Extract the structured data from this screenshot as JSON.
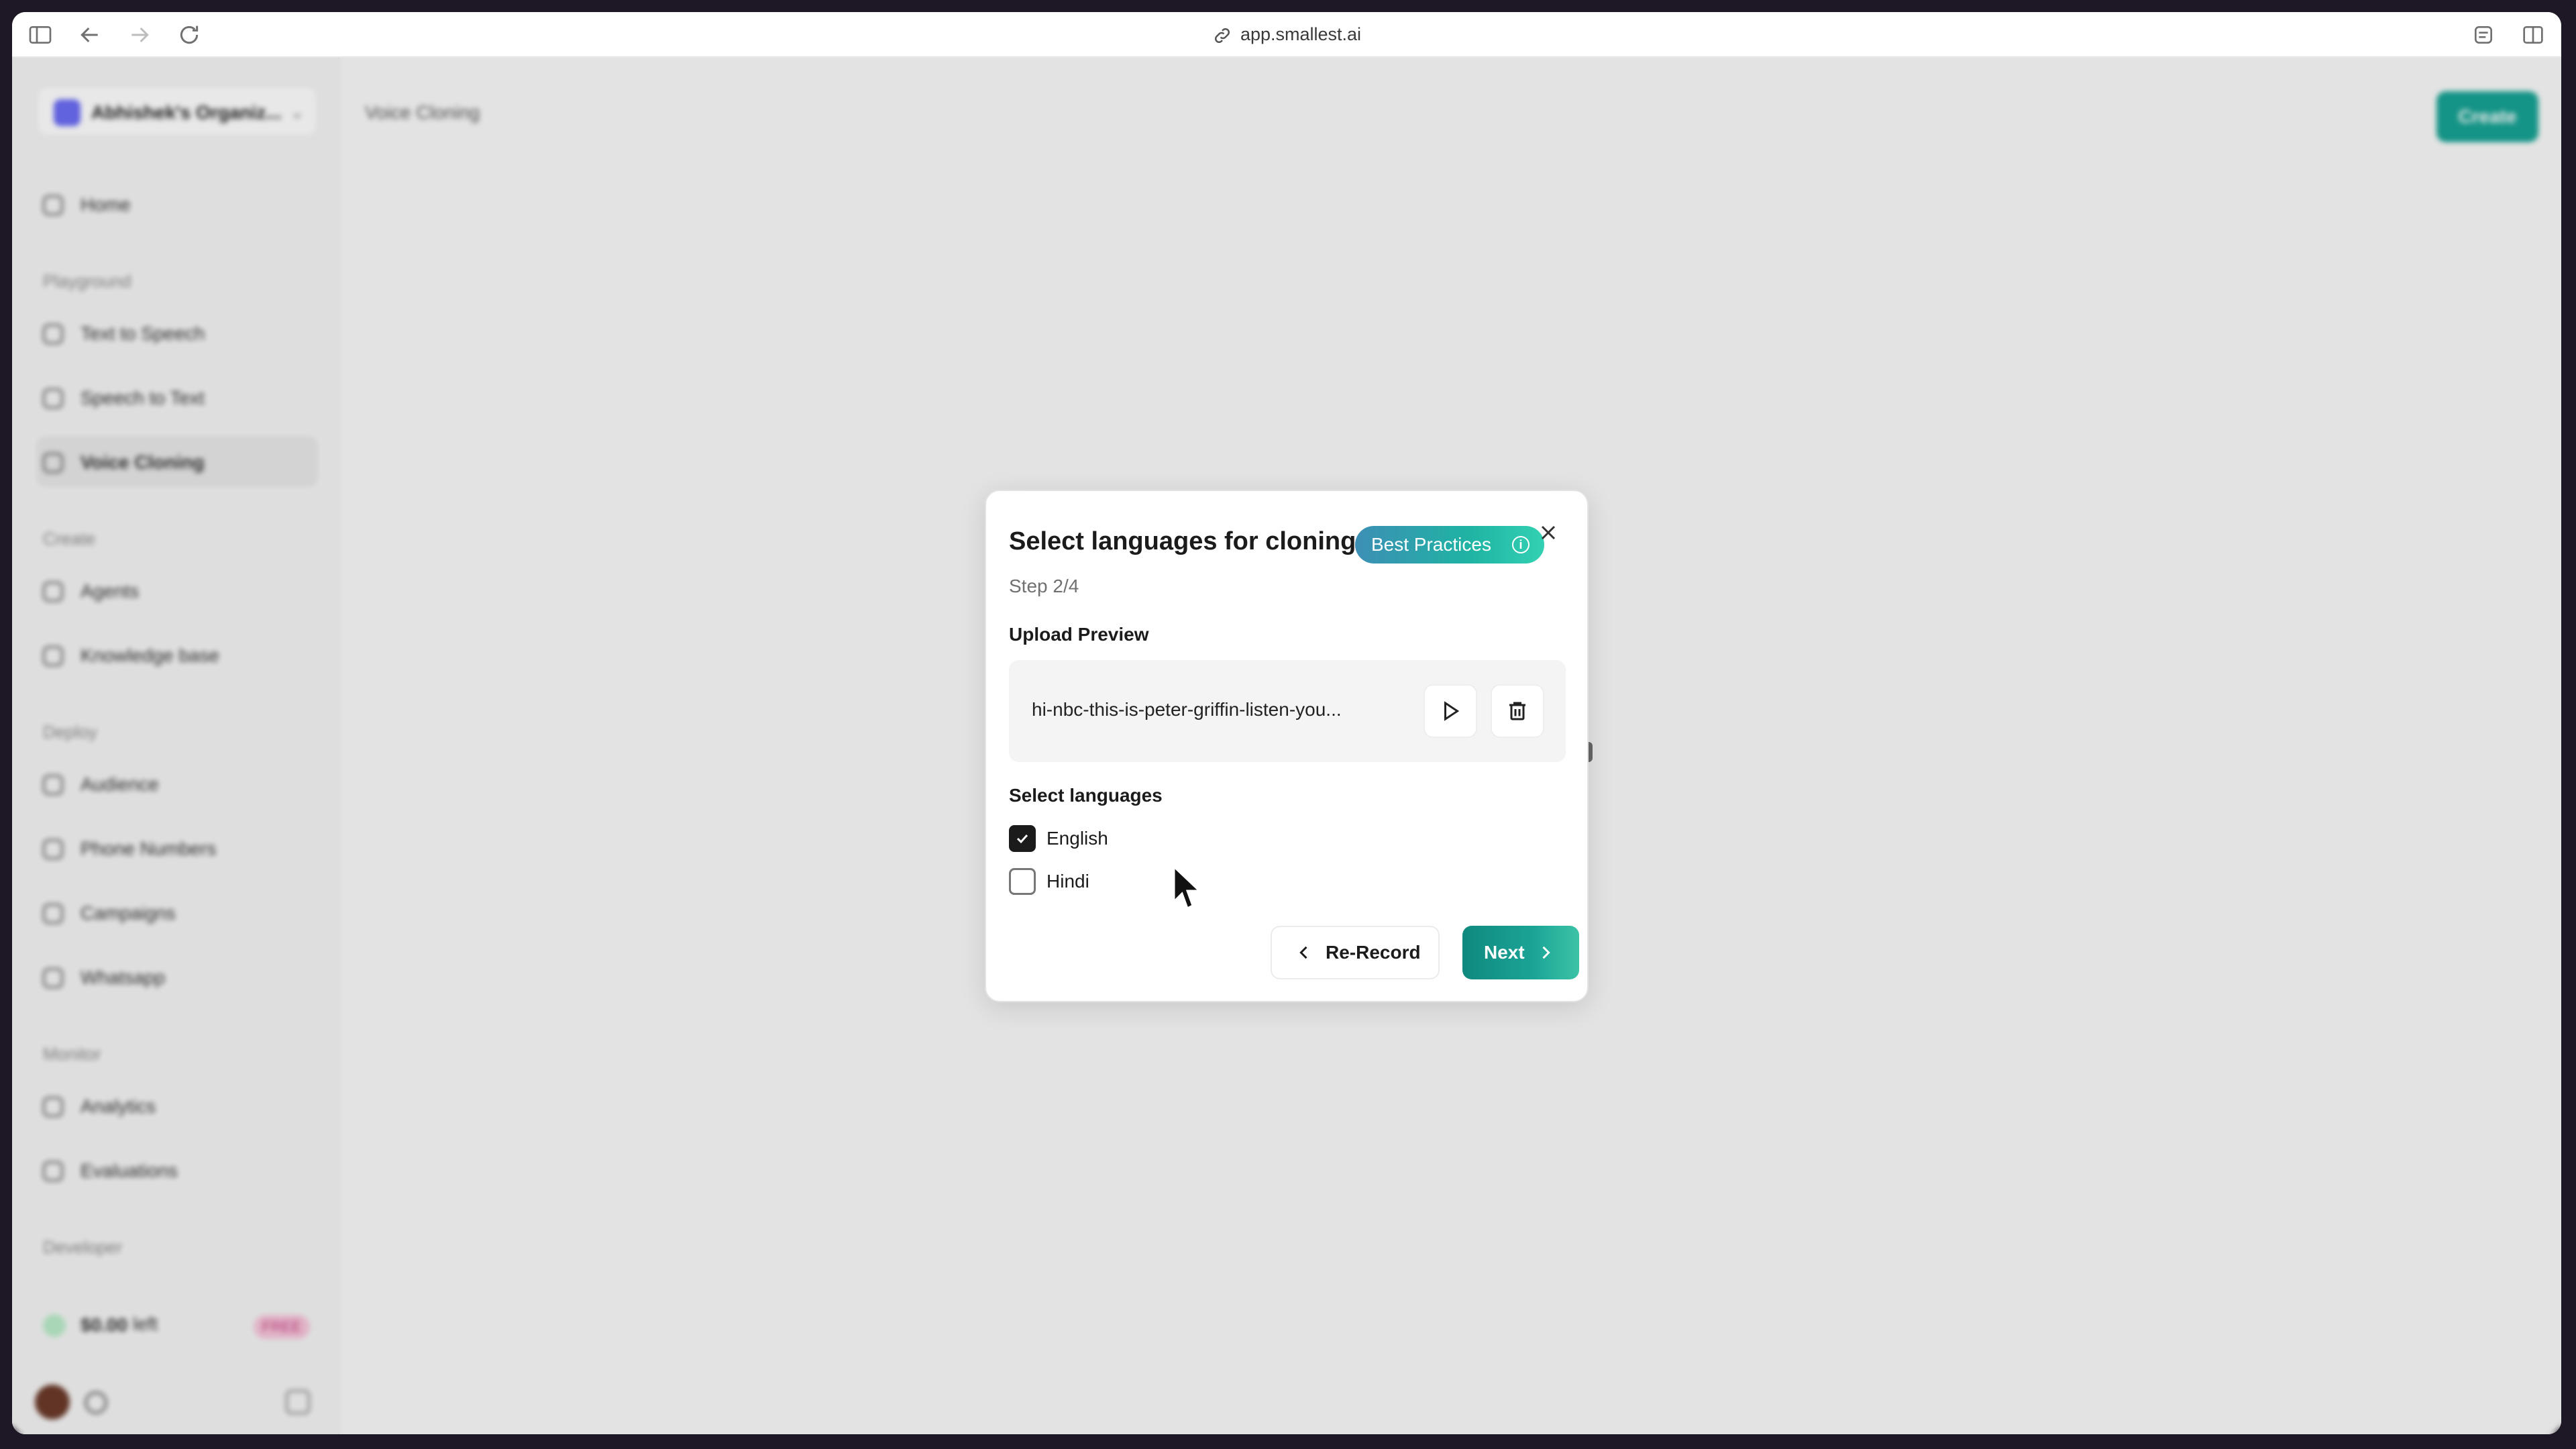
{
  "browser": {
    "url": "app.smallest.ai"
  },
  "sidebar": {
    "org_name": "Abhishek's Organiz...",
    "items": [
      {
        "label": "Home"
      },
      {
        "label": "Text to Speech"
      },
      {
        "label": "Speech to Text"
      },
      {
        "label": "Voice Cloning"
      },
      {
        "label": "Agents"
      },
      {
        "label": "Knowledge base"
      },
      {
        "label": "Audience"
      },
      {
        "label": "Phone Numbers"
      },
      {
        "label": "Campaigns"
      },
      {
        "label": "Whatsapp"
      },
      {
        "label": "Analytics"
      },
      {
        "label": "Evaluations"
      }
    ],
    "sections": [
      "Playground",
      "Create",
      "Deploy",
      "Monitor",
      "Developer"
    ],
    "credits": {
      "value": "$0.00",
      "unit": "left",
      "badge": "FREE"
    }
  },
  "header": {
    "breadcrumb": "Voice Cloning",
    "create_label": "Create"
  },
  "modal": {
    "title": "Select languages for cloning",
    "badge": "Best Practices",
    "badge_info_icon": "i",
    "step": "Step 2/4",
    "upload_label": "Upload Preview",
    "file_name": "hi-nbc-this-is-peter-griffin-listen-you...",
    "languages_label": "Select languages",
    "languages": [
      {
        "label": "English",
        "checked": true
      },
      {
        "label": "Hindi",
        "checked": false
      }
    ],
    "rerecord_label": "Re-Record",
    "next_label": "Next"
  },
  "colors": {
    "accent": "#17a394",
    "badge_start": "#3d8fb5",
    "badge_end": "#33d1b3"
  }
}
